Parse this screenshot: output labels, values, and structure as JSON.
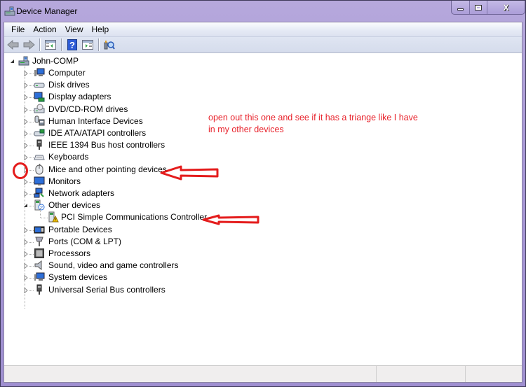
{
  "window": {
    "title": "Device Manager",
    "caption_buttons": [
      {
        "name": "minimize",
        "icon": "minimize-icon"
      },
      {
        "name": "maximize",
        "icon": "maximize-icon"
      },
      {
        "name": "close",
        "icon": "close-icon",
        "glyph": "X"
      }
    ]
  },
  "menubar": {
    "items": [
      "File",
      "Action",
      "View",
      "Help"
    ]
  },
  "toolbar": {
    "buttons": [
      {
        "name": "back",
        "icon": "back-arrow-icon",
        "tooltip": "Back"
      },
      {
        "name": "forward",
        "icon": "forward-arrow-icon",
        "tooltip": "Forward"
      },
      {
        "name": "show-hide-console-tree",
        "icon": "console-tree-icon"
      },
      {
        "name": "help",
        "icon": "help-icon",
        "glyph": "?"
      },
      {
        "name": "show-hide-action-pane",
        "icon": "action-pane-icon"
      },
      {
        "name": "scan-hardware-changes",
        "icon": "scan-hardware-icon"
      }
    ]
  },
  "tree": {
    "root": {
      "label": "John-COMP",
      "icon": "computer-root-icon",
      "expanded": true
    },
    "categories": [
      {
        "label": "Computer",
        "icon": "computer-icon",
        "expanded": false
      },
      {
        "label": "Disk drives",
        "icon": "disk-drive-icon",
        "expanded": false
      },
      {
        "label": "Display adapters",
        "icon": "display-adapter-icon",
        "expanded": false
      },
      {
        "label": "DVD/CD-ROM drives",
        "icon": "dvd-drive-icon",
        "expanded": false
      },
      {
        "label": "Human Interface Devices",
        "icon": "hid-icon",
        "expanded": false
      },
      {
        "label": "IDE ATA/ATAPI controllers",
        "icon": "ide-controller-icon",
        "expanded": false
      },
      {
        "label": "IEEE 1394 Bus host controllers",
        "icon": "ieee1394-icon",
        "expanded": false
      },
      {
        "label": "Keyboards",
        "icon": "keyboard-icon",
        "expanded": false
      },
      {
        "label": "Mice and other pointing devices",
        "icon": "mouse-icon",
        "expanded": false
      },
      {
        "label": "Monitors",
        "icon": "monitor-icon",
        "expanded": false
      },
      {
        "label": "Network adapters",
        "icon": "network-adapter-icon",
        "expanded": false
      },
      {
        "label": "Other devices",
        "icon": "unknown-device-icon",
        "expanded": true,
        "children": [
          {
            "label": "PCI Simple Communications Controller",
            "icon": "warning-device-icon",
            "warning": true
          }
        ]
      },
      {
        "label": "Portable Devices",
        "icon": "portable-device-icon",
        "expanded": false
      },
      {
        "label": "Ports (COM & LPT)",
        "icon": "port-icon",
        "expanded": false
      },
      {
        "label": "Processors",
        "icon": "processor-icon",
        "expanded": false
      },
      {
        "label": "Sound, video and game controllers",
        "icon": "sound-icon",
        "expanded": false
      },
      {
        "label": "System devices",
        "icon": "system-device-icon",
        "expanded": false
      },
      {
        "label": "Universal Serial Bus controllers",
        "icon": "usb-icon",
        "expanded": false
      }
    ]
  },
  "annotations": {
    "note": "open out this one and see if it has a triange like I have in my other devices",
    "color": "#e8222b",
    "targets": [
      "Mice and other pointing devices",
      "PCI Simple Communications Controller"
    ]
  },
  "statusbar": {
    "panes": [
      "",
      "",
      ""
    ]
  }
}
